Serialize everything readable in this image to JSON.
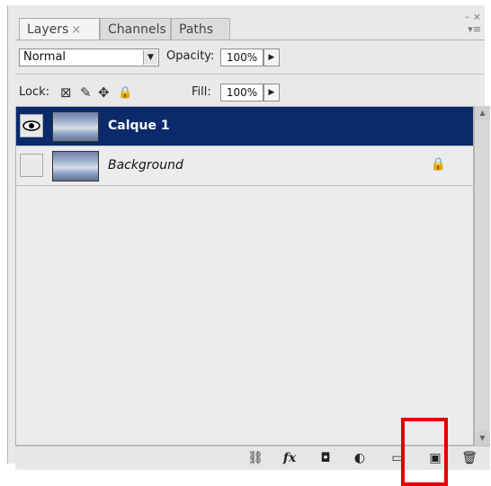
{
  "tabs": [
    {
      "label": "Layers",
      "close": "×"
    },
    {
      "label": "Channels"
    },
    {
      "label": "Paths"
    }
  ],
  "panel_controls": {
    "minimize": "– ×",
    "menu": "▾≡"
  },
  "blend": {
    "mode": "Normal",
    "opacity_label": "Opacity:",
    "opacity_value": "100%"
  },
  "lock": {
    "label": "Lock:",
    "fill_label": "Fill:",
    "fill_value": "100%"
  },
  "layers": [
    {
      "name": "Calque 1",
      "visible": true,
      "selected": true,
      "locked": false
    },
    {
      "name": "Background",
      "visible": false,
      "selected": false,
      "locked": true
    }
  ],
  "icons": {
    "link": "⛓",
    "fx": "fx",
    "mask": "◘",
    "adjustment": "◐",
    "group": "▭",
    "new_layer": "▣",
    "trash": "🗑",
    "lock_transparent": "⊠",
    "lock_paint": "✎",
    "lock_move": "✥",
    "lock_all": "🔒",
    "layer_lock": "🔒"
  },
  "colors": {
    "selected_row": "#0a2a6b",
    "highlight": "#e30000"
  }
}
